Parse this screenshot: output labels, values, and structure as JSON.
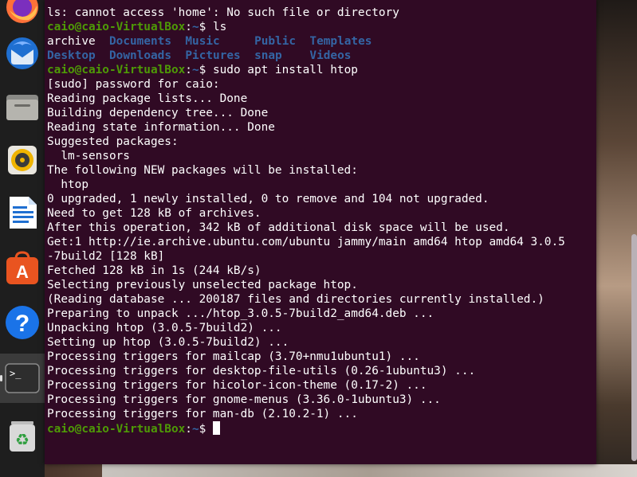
{
  "dock": {
    "items": [
      {
        "name": "firefox-launcher",
        "icon": "firefox-icon"
      },
      {
        "name": "thunderbird-launcher",
        "icon": "thunderbird-icon"
      },
      {
        "name": "files-launcher",
        "icon": "folder-icon"
      },
      {
        "name": "rhythmbox-launcher",
        "icon": "speaker-icon"
      },
      {
        "name": "writer-launcher",
        "icon": "document-icon"
      },
      {
        "name": "software-launcher",
        "icon": "app-store-icon"
      },
      {
        "name": "help-launcher",
        "icon": "help-icon"
      },
      {
        "name": "terminal-launcher",
        "icon": "terminal-icon",
        "active": true
      },
      {
        "name": "trash-launcher",
        "icon": "trash-icon"
      }
    ],
    "help_glyph": "?",
    "terminal_glyph": ">_",
    "trash_glyph": "♻"
  },
  "terminal": {
    "prompt": {
      "user": "caio@caio-VirtualBox",
      "sep": ":",
      "path": "~",
      "sym": "$"
    },
    "lines": [
      {
        "kind": "text",
        "text": "ls: cannot access 'home': No such file or directory"
      },
      {
        "kind": "prompt",
        "cmd": " ls"
      },
      {
        "kind": "ls",
        "cols": [
          "archive",
          "Documents",
          "Music",
          "Public",
          "Templates"
        ],
        "dirs": [
          false,
          true,
          true,
          true,
          true
        ]
      },
      {
        "kind": "ls",
        "cols": [
          "Desktop",
          "Downloads",
          "Pictures",
          "snap",
          "Videos"
        ],
        "dirs": [
          true,
          true,
          true,
          true,
          true
        ]
      },
      {
        "kind": "prompt",
        "cmd": " sudo apt install htop"
      },
      {
        "kind": "text",
        "text": "[sudo] password for caio:"
      },
      {
        "kind": "text",
        "text": "Reading package lists... Done"
      },
      {
        "kind": "text",
        "text": "Building dependency tree... Done"
      },
      {
        "kind": "text",
        "text": "Reading state information... Done"
      },
      {
        "kind": "text",
        "text": "Suggested packages:"
      },
      {
        "kind": "text",
        "text": "  lm-sensors"
      },
      {
        "kind": "text",
        "text": "The following NEW packages will be installed:"
      },
      {
        "kind": "text",
        "text": "  htop"
      },
      {
        "kind": "text",
        "text": "0 upgraded, 1 newly installed, 0 to remove and 104 not upgraded."
      },
      {
        "kind": "text",
        "text": "Need to get 128 kB of archives."
      },
      {
        "kind": "text",
        "text": "After this operation, 342 kB of additional disk space will be used."
      },
      {
        "kind": "text",
        "text": "Get:1 http://ie.archive.ubuntu.com/ubuntu jammy/main amd64 htop amd64 3.0.5"
      },
      {
        "kind": "text",
        "text": "-7build2 [128 kB]"
      },
      {
        "kind": "text",
        "text": "Fetched 128 kB in 1s (244 kB/s)"
      },
      {
        "kind": "text",
        "text": "Selecting previously unselected package htop."
      },
      {
        "kind": "text",
        "text": "(Reading database ... 200187 files and directories currently installed.)"
      },
      {
        "kind": "text",
        "text": "Preparing to unpack .../htop_3.0.5-7build2_amd64.deb ..."
      },
      {
        "kind": "text",
        "text": "Unpacking htop (3.0.5-7build2) ..."
      },
      {
        "kind": "text",
        "text": "Setting up htop (3.0.5-7build2) ..."
      },
      {
        "kind": "text",
        "text": "Processing triggers for mailcap (3.70+nmu1ubuntu1) ..."
      },
      {
        "kind": "text",
        "text": "Processing triggers for desktop-file-utils (0.26-1ubuntu3) ..."
      },
      {
        "kind": "text",
        "text": "Processing triggers for hicolor-icon-theme (0.17-2) ..."
      },
      {
        "kind": "text",
        "text": "Processing triggers for gnome-menus (3.36.0-1ubuntu3) ..."
      },
      {
        "kind": "text",
        "text": "Processing triggers for man-db (2.10.2-1) ..."
      },
      {
        "kind": "prompt",
        "cmd": " ",
        "cursor": true
      }
    ]
  },
  "colors": {
    "terminal_bg": "#300a24",
    "prompt_user": "#4e9a06",
    "prompt_path": "#3465a4",
    "text": "#ffffff"
  }
}
